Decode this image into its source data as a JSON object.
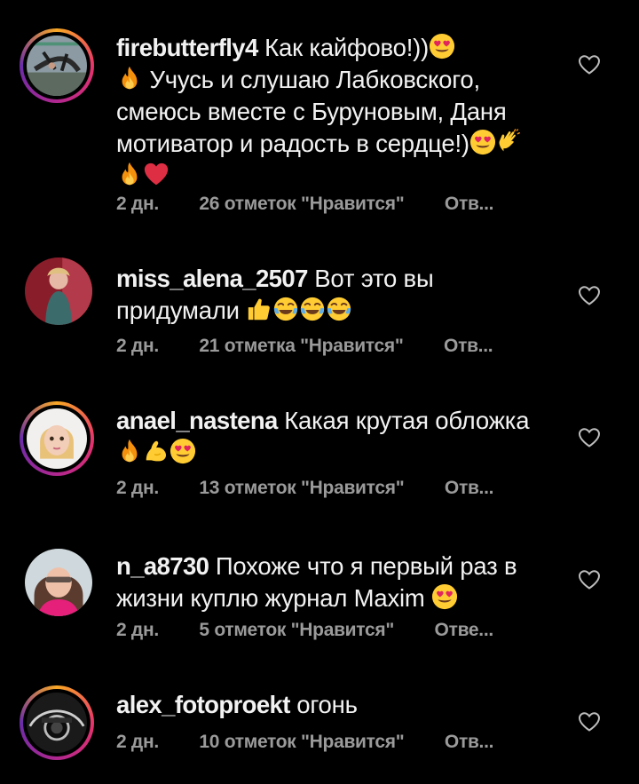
{
  "comments": [
    {
      "username": "firebutterfly4",
      "text_parts": [
        "Как кайфово!))",
        "Учусь и слушаю Лабковского, смеюсь вместе с Буруновым, Даня мотиватор и радость в сердце!)"
      ],
      "emojis": [
        "heart-eyes-emoji",
        "fire-emoji",
        "heart-eyes-emoji",
        "clapping-hand-emoji",
        "fire-emoji",
        "red-heart-emoji"
      ],
      "time": "2 дн.",
      "likes": "26 отметок \"Нравится\"",
      "reply": "Отв..."
    },
    {
      "username": "miss_alena_2507",
      "text_parts": [
        "Вот это вы придумали"
      ],
      "emojis": [
        "thumbs-up-emoji",
        "tears-of-joy-emoji",
        "tears-of-joy-emoji",
        "tears-of-joy-emoji"
      ],
      "time": "2 дн.",
      "likes": "21 отметка \"Нравится\"",
      "reply": "Отв..."
    },
    {
      "username": "anael_nastena",
      "text_parts": [
        "Какая крутая обложка"
      ],
      "emojis": [
        "fire-emoji",
        "flexed-biceps-emoji",
        "heart-eyes-emoji"
      ],
      "time": "2 дн.",
      "likes": "13 отметок \"Нравится\"",
      "reply": "Отв..."
    },
    {
      "username": "n_a8730",
      "text_parts": [
        "Похоже что я первый раз в жизни куплю журнал Maxim"
      ],
      "emojis": [
        "heart-eyes-emoji"
      ],
      "time": "2 дн.",
      "likes": "5 отметок \"Нравится\"",
      "reply": "Отве..."
    },
    {
      "username": "alex_fotoproekt",
      "text_parts": [
        "огонь"
      ],
      "emojis": [],
      "time": "2 дн.",
      "likes": "10 отметок \"Нравится\"",
      "reply": "Отв..."
    }
  ],
  "icons": {
    "like": "heart-outline-icon"
  },
  "colors": {
    "background": "#000000",
    "text": "#f2f2f2",
    "meta": "#9a9a9a"
  }
}
